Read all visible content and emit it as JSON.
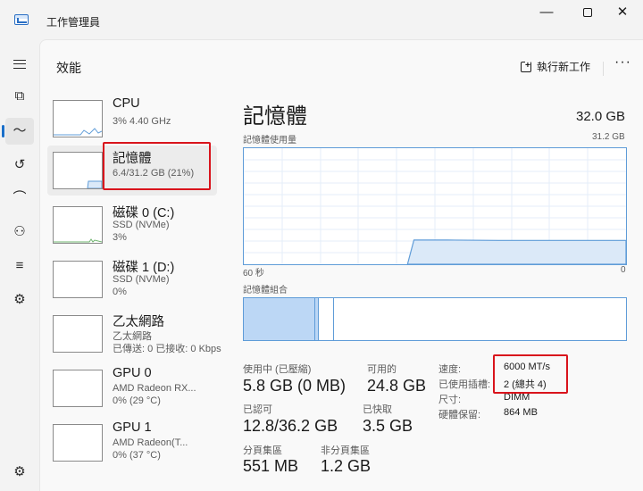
{
  "app": {
    "title": "工作管理員",
    "min": "—",
    "max": "",
    "close": "✕"
  },
  "rail": {
    "menu": "",
    "processes": "⧉",
    "performance": "〜",
    "history": "↺",
    "startup": "⌒",
    "users": "⚇",
    "details": "≡",
    "services": "⚙",
    "settings": "⚙"
  },
  "header": {
    "title": "效能",
    "run_task": "執行新工作",
    "more": "···"
  },
  "devices": [
    {
      "name": "CPU",
      "lines": [
        "3% 4.40 GHz"
      ]
    },
    {
      "name": "記憶體",
      "lines": [
        "6.4/31.2 GB (21%)"
      ]
    },
    {
      "name": "磁碟 0 (C:)",
      "lines": [
        "SSD (NVMe)",
        "3%"
      ]
    },
    {
      "name": "磁碟 1 (D:)",
      "lines": [
        "SSD (NVMe)",
        "0%"
      ]
    },
    {
      "name": "乙太網路",
      "lines": [
        "乙太網路",
        "已傳送: 0 已接收: 0 Kbps"
      ]
    },
    {
      "name": "GPU 0",
      "lines": [
        "AMD Radeon RX...",
        "0% (29 °C)"
      ]
    },
    {
      "name": "GPU 1",
      "lines": [
        "AMD Radeon(T...",
        "0% (37 °C)"
      ]
    }
  ],
  "detail": {
    "title": "記憶體",
    "total": "32.0 GB",
    "usage_label": "記憶體使用量",
    "usage_max": "31.2 GB",
    "time_left": "60 秒",
    "time_right": "0",
    "composition_label": "記憶體組合",
    "graph_history": [
      {
        "t": 60,
        "gb": 0
      },
      {
        "t": 34.3,
        "gb": 0
      },
      {
        "t": 33.3,
        "gb": 6.5
      },
      {
        "t": 28,
        "gb": 6.5
      },
      {
        "t": 20,
        "gb": 6.4
      },
      {
        "t": 0,
        "gb": 6.4
      }
    ],
    "graph_range": {
      "t": [
        60,
        0
      ],
      "gb": [
        0,
        31.2
      ]
    },
    "composition": {
      "in_use_gb": 5.8,
      "modified_gb": 0.1,
      "standby_gb": 1.3,
      "free_gb": 24.0
    },
    "stats": {
      "in_use_label": "使用中 (已壓縮)",
      "in_use_value": "5.8 GB (0 MB)",
      "available_label": "可用的",
      "available_value": "24.8 GB",
      "committed_label": "已認可",
      "committed_value": "12.8/36.2 GB",
      "cached_label": "已快取",
      "cached_value": "3.5 GB",
      "paged_label": "分頁集區",
      "paged_value": "551 MB",
      "nonpaged_label": "非分頁集區",
      "nonpaged_value": "1.2 GB"
    },
    "props": {
      "speed_label": "速度:",
      "speed_value": "6000 MT/s",
      "slots_label": "已使用插槽:",
      "slots_value": "2 (總共 4)",
      "form_label": "尺寸:",
      "form_value": "DIMM",
      "reserved_label": "硬體保留:",
      "reserved_value": "864 MB"
    }
  },
  "colors": {
    "accent": "#1a6fc9",
    "graph_line": "#5f9cd8",
    "graph_fill": "#dbe9f8",
    "highlight": "#d9141c"
  }
}
